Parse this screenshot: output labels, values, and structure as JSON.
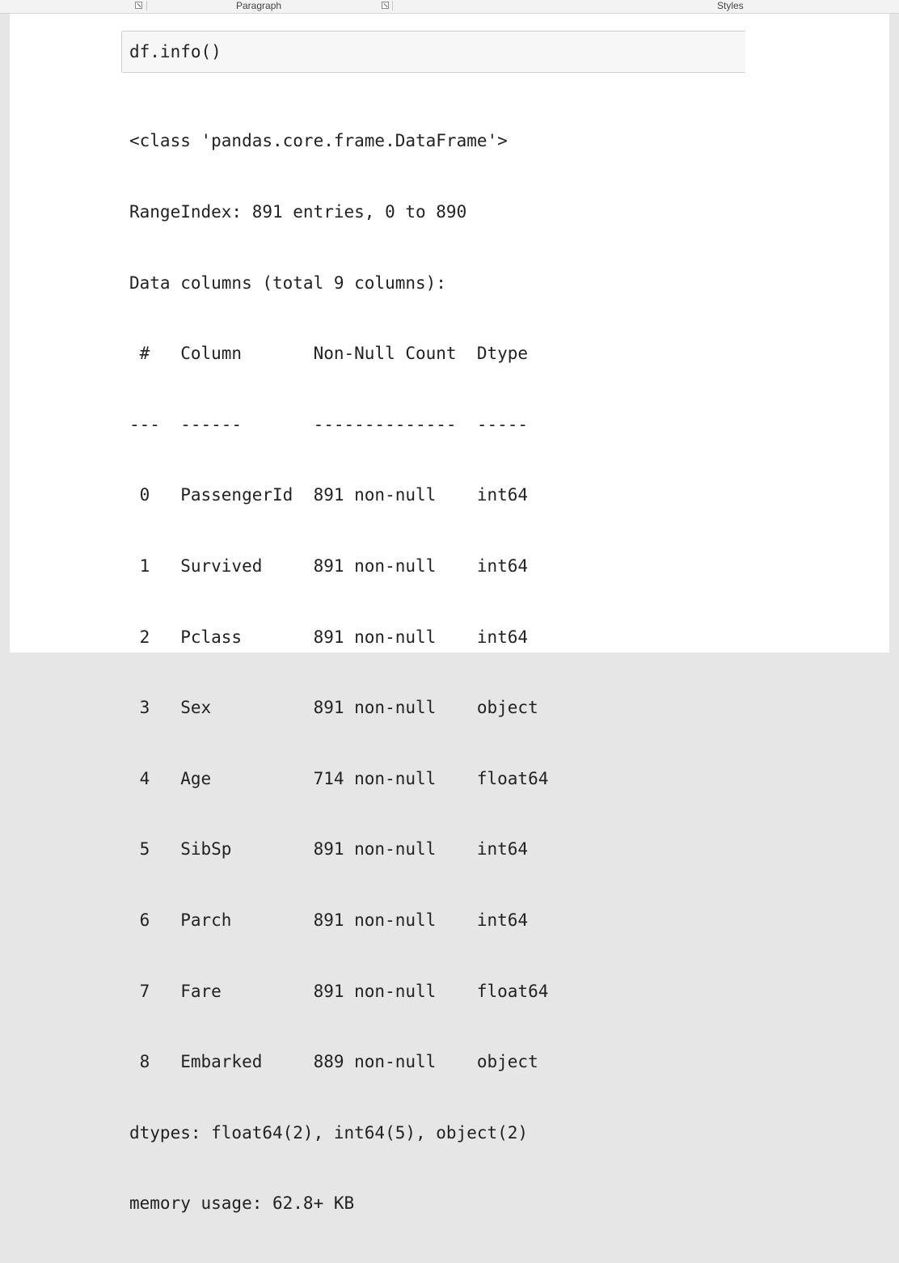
{
  "ribbon": {
    "paragraph_label": "Paragraph",
    "styles_label": "Styles"
  },
  "cell": {
    "code": "df.info()"
  },
  "output": {
    "lines": [
      "<class 'pandas.core.frame.DataFrame'>",
      "RangeIndex: 891 entries, 0 to 890",
      "Data columns (total 9 columns):",
      " #   Column       Non-Null Count  Dtype  ",
      "---  ------       --------------  -----  ",
      " 0   PassengerId  891 non-null    int64  ",
      " 1   Survived     891 non-null    int64  ",
      " 2   Pclass       891 non-null    int64  ",
      " 3   Sex          891 non-null    object ",
      " 4   Age          714 non-null    float64",
      " 5   SibSp        891 non-null    int64  ",
      " 6   Parch        891 non-null    int64  ",
      " 7   Fare         891 non-null    float64",
      " 8   Embarked     889 non-null    object ",
      "dtypes: float64(2), int64(5), object(2)",
      "memory usage: 62.8+ KB"
    ]
  },
  "icons": {
    "launcher_left": "dialog-launcher-icon",
    "launcher_mid": "dialog-launcher-icon"
  }
}
